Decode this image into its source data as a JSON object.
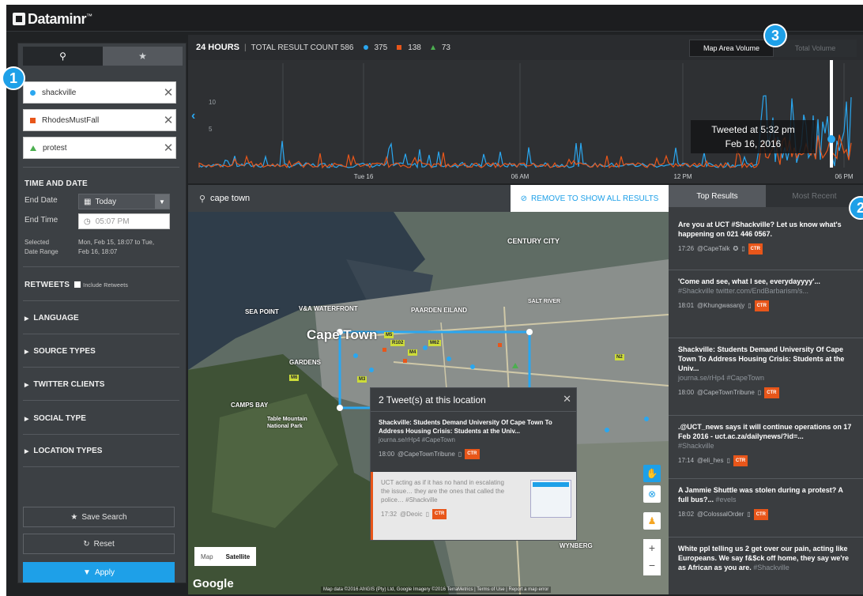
{
  "app": {
    "logo_text": "Dataminr",
    "logo_mark": "™"
  },
  "colors": {
    "blue": "#2aa7f0",
    "orange": "#e8561a",
    "green": "#4caf50",
    "accent": "#1ea0e8"
  },
  "badges": [
    "1",
    "2",
    "3"
  ],
  "sidebar": {
    "tabs": [
      {
        "icon": "search-icon",
        "glyph": "⚲"
      },
      {
        "icon": "star-icon",
        "glyph": "★"
      }
    ],
    "terms": [
      {
        "label": "shackville",
        "color": "#2aa7f0",
        "shape": "dot"
      },
      {
        "label": "RhodesMustFall",
        "color": "#e8561a",
        "shape": "square"
      },
      {
        "label": "protest",
        "color": "#4caf50",
        "shape": "triangle"
      }
    ],
    "remove_glyph": "✕",
    "time_title": "TIME AND DATE",
    "end_date_label": "End Date",
    "end_date_value": "Today",
    "end_time_label": "End Time",
    "end_time_value": "05:07 PM",
    "range_label_1": "Selected",
    "range_label_2": "Date Range",
    "range_value_1": "Mon, Feb 15, 18:07 to Tue,",
    "range_value_2": "Feb 16, 18:07",
    "retweets_title": "RETWEETS",
    "retweets_option": "Include Retweets",
    "facets": [
      "LANGUAGE",
      "SOURCE TYPES",
      "TWITTER CLIENTS",
      "SOCIAL TYPE",
      "LOCATION TYPES"
    ],
    "save_label": "Save Search",
    "reset_label": "Reset",
    "apply_label": "Apply"
  },
  "header": {
    "period": "24 HOURS",
    "total_label": "TOTAL RESULT COUNT 586",
    "counts": [
      {
        "value": "375",
        "color": "#2aa7f0"
      },
      {
        "value": "138",
        "color": "#e8561a"
      },
      {
        "value": "73",
        "color": "#4caf50"
      }
    ],
    "volume_tabs": [
      "Map Area Volume",
      "Total Volume"
    ]
  },
  "chart_data": {
    "type": "line",
    "x_tick_labels": [
      "Tue 16",
      "06 AM",
      "12 PM",
      "06 PM"
    ],
    "y_tick_labels": [
      "5",
      "10"
    ],
    "series": [
      {
        "color": "#2aa7f0"
      },
      {
        "color": "#e8561a"
      }
    ],
    "tooltip_line1": "Tweeted at 5:32 pm",
    "tooltip_line2": "Feb 16, 2016",
    "grid": true
  },
  "location": {
    "query": "cape town",
    "remove_label": "REMOVE TO SHOW ALL RESULTS"
  },
  "map": {
    "labels": {
      "city": "Cape Town",
      "century": "CENTURY CITY",
      "sea_point": "SEA POINT",
      "waterfront": "V&A WATERFRONT",
      "paarden": "PAARDEN EILAND",
      "gardens": "GARDENS",
      "camps_bay": "CAMPS BAY",
      "park": "Table Mountain National Park",
      "wynberg": "WYNBERG",
      "salt": "SALT RIVER"
    },
    "roads": [
      "M5",
      "M3",
      "R102",
      "M6",
      "M62",
      "M4",
      "N2"
    ],
    "popup_title": "2 Tweet(s) at this location",
    "popup_close": "✕",
    "popup_t1_text": "Shackville: Students Demand University Of Cape Town To Address Housing Crisis: Students at the Univ...",
    "popup_t1_link": "journa.se/rHp4 #CapeTown",
    "popup_t1_time": "18:00",
    "popup_t1_user": "@CapeTownTribune",
    "popup_t2_text": "UCT acting as if it has no hand in escalating the issue… they are the ones that called the police…",
    "popup_t2_hash": "#Shackville",
    "popup_t2_time": "17:32",
    "popup_t2_user": "@Deoic",
    "ctr": "CTR",
    "maptype": [
      "Map",
      "Satellite"
    ],
    "zoom_in": "+",
    "zoom_out": "−",
    "google": "Google",
    "attribution": "Map data ©2016 AfriGIS (Pty) Ltd, Google Imagery ©2016 TerraMetrics | Terms of Use | Report a map error"
  },
  "results": {
    "tabs": [
      "Top Results",
      "Most Recent"
    ],
    "items": [
      {
        "text": "Are you at UCT #Shackville? Let us know what's happening on 021 446 0567.",
        "hash": "",
        "time": "17:26",
        "user": "@CapeTalk"
      },
      {
        "text": "'Come and see, what I see, everydayyyy'...",
        "hash": "#Shackville twitter.com/EndBarbarism/s...",
        "time": "18:01",
        "user": "@Khungwasanjy"
      },
      {
        "text": "Shackville: Students Demand University Of Cape Town To Address Housing Crisis: Students at the Univ...",
        "hash": "journa.se/rHp4 #CapeTown",
        "time": "18:00",
        "user": "@CapeTownTribune"
      },
      {
        "text": ".@UCT_news says it will continue operations on 17 Feb 2016 - uct.ac.za/dailynews/?id=...",
        "hash": "#Shackville",
        "time": "17:14",
        "user": "@eli_hes"
      },
      {
        "text": "A Jammie Shuttle was stolen during a protest? A full bus?...",
        "hash": "#evels",
        "time": "18:02",
        "user": "@ColossalOrder"
      },
      {
        "text": "White ppl telling us 2 get over our pain, acting like Europeans. We say f&$ck off home, they say we're as African as you are.",
        "hash": "#Shackville",
        "time": "",
        "user": ""
      }
    ]
  }
}
